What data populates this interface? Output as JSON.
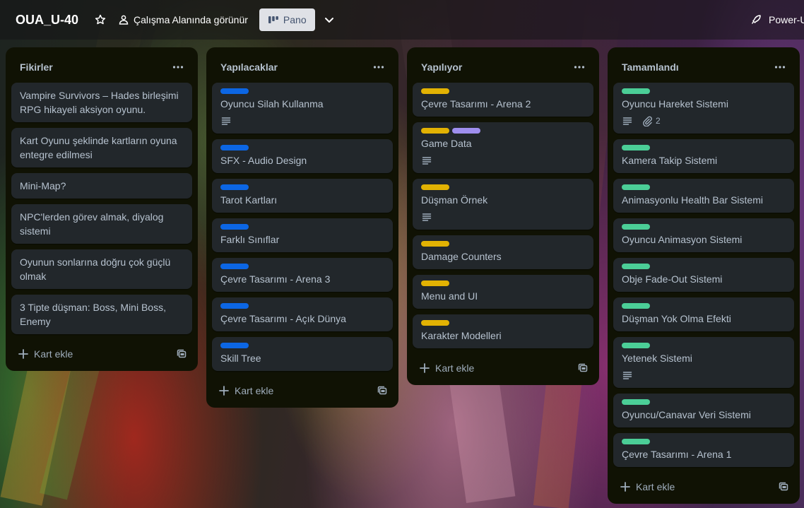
{
  "header": {
    "board_title": "OUA_U-40",
    "visibility": "Çalışma Alanında görünür",
    "view_button": "Pano",
    "powerups": "Power-U"
  },
  "colors": {
    "blue": "#0c66e4",
    "yellow": "#e2b203",
    "purple": "#9f8fef",
    "green": "#4bce97"
  },
  "add_card_label": "Kart ekle",
  "lists": [
    {
      "title": "Fikirler",
      "cards": [
        {
          "title": "Vampire Survivors – Hades birleşimi RPG hikayeli aksiyon oyunu.",
          "labels": []
        },
        {
          "title": "Kart Oyunu şeklinde kartların oyuna entegre edilmesi",
          "labels": []
        },
        {
          "title": "Mini-Map?",
          "labels": []
        },
        {
          "title": "NPC'lerden görev almak, diyalog sistemi",
          "labels": []
        },
        {
          "title": "Oyunun sonlarına doğru çok güçlü olmak",
          "labels": []
        },
        {
          "title": "3 Tipte düşman: Boss, Mini Boss, Enemy",
          "labels": []
        }
      ]
    },
    {
      "title": "Yapılacaklar",
      "cards": [
        {
          "title": "Oyuncu Silah Kullanma",
          "labels": [
            "blue"
          ],
          "description": true
        },
        {
          "title": "SFX - Audio Design",
          "labels": [
            "blue"
          ]
        },
        {
          "title": "Tarot Kartları",
          "labels": [
            "blue"
          ]
        },
        {
          "title": "Farklı Sınıflar",
          "labels": [
            "blue"
          ]
        },
        {
          "title": "Çevre Tasarımı - Arena 3",
          "labels": [
            "blue"
          ]
        },
        {
          "title": "Çevre Tasarımı - Açık Dünya",
          "labels": [
            "blue"
          ]
        },
        {
          "title": "Skill Tree",
          "labels": [
            "blue"
          ]
        }
      ]
    },
    {
      "title": "Yapılıyor",
      "cards": [
        {
          "title": "Çevre Tasarımı - Arena 2",
          "labels": [
            "yellow"
          ]
        },
        {
          "title": "Game Data",
          "labels": [
            "yellow",
            "purple"
          ],
          "description": true
        },
        {
          "title": "Düşman Örnek",
          "labels": [
            "yellow"
          ],
          "description": true
        },
        {
          "title": "Damage Counters",
          "labels": [
            "yellow"
          ]
        },
        {
          "title": "Menu and UI",
          "labels": [
            "yellow"
          ]
        },
        {
          "title": "Karakter Modelleri",
          "labels": [
            "yellow"
          ]
        }
      ]
    },
    {
      "title": "Tamamlandı",
      "cards": [
        {
          "title": "Oyuncu Hareket Sistemi",
          "labels": [
            "green"
          ],
          "description": true,
          "attachments": "2"
        },
        {
          "title": "Kamera Takip Sistemi",
          "labels": [
            "green"
          ]
        },
        {
          "title": "Animasyonlu Health Bar Sistemi",
          "labels": [
            "green"
          ]
        },
        {
          "title": "Oyuncu Animasyon Sistemi",
          "labels": [
            "green"
          ]
        },
        {
          "title": "Obje Fade-Out Sistemi",
          "labels": [
            "green"
          ]
        },
        {
          "title": "Düşman Yok Olma Efekti",
          "labels": [
            "green"
          ]
        },
        {
          "title": "Yetenek Sistemi",
          "labels": [
            "green"
          ],
          "description": true
        },
        {
          "title": "Oyuncu/Canavar Veri Sistemi",
          "labels": [
            "green"
          ]
        },
        {
          "title": "Çevre Tasarımı - Arena 1",
          "labels": [
            "green"
          ]
        }
      ]
    }
  ]
}
